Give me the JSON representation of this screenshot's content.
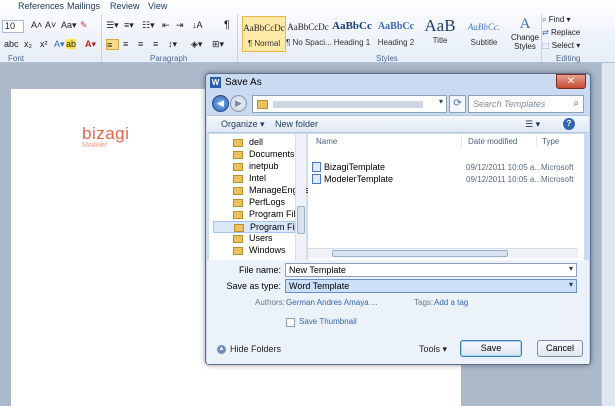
{
  "ribbon": {
    "tabs": [
      "References",
      "Mailings",
      "Review",
      "View"
    ],
    "font_size": "10",
    "groups": {
      "font": "Font",
      "paragraph": "Paragraph",
      "styles": "Styles",
      "editing": "Editing"
    },
    "styles": [
      {
        "preview": "AaBbCcDc",
        "name": "¶ Normal"
      },
      {
        "preview": "AaBbCcDc",
        "name": "¶ No Spaci..."
      },
      {
        "preview": "AaBbCc",
        "name": "Heading 1"
      },
      {
        "preview": "AaBbCc",
        "name": "Heading 2"
      },
      {
        "preview": "AaB",
        "name": "Title"
      },
      {
        "preview": "AaBbCc.",
        "name": "Subtitle"
      }
    ],
    "change_styles": "Change Styles",
    "editing": {
      "find": "Find",
      "replace": "Replace",
      "select": "Select"
    }
  },
  "document": {
    "logo_main": "bizagi",
    "logo_sub": "Modeler"
  },
  "dialog": {
    "title": "Save As",
    "search_placeholder": "Search Templates",
    "toolbar": {
      "organize": "Organize",
      "new_folder": "New folder"
    },
    "nav_items": [
      "dell",
      "Documents",
      "inetpub",
      "Intel",
      "ManageEngine",
      "PerfLogs",
      "Program Files",
      "Program Files (",
      "Users",
      "Windows"
    ],
    "columns": {
      "name": "Name",
      "date": "Date modified",
      "type": "Type"
    },
    "files": [
      {
        "name": "BizagiTemplate",
        "date": "09/12/2011 10:05 a...",
        "type": "Microsoft"
      },
      {
        "name": "ModelerTemplate",
        "date": "09/12/2011 10:05 a...",
        "type": "Microsoft"
      }
    ],
    "file_name_label": "File name:",
    "file_name_value": "New Template",
    "save_type_label": "Save as type:",
    "save_type_value": "Word Template",
    "authors_label": "Authors:",
    "authors_value": "German Andres Amaya ...",
    "tags_label": "Tags:",
    "tags_value": "Add a tag",
    "save_thumbnail": "Save Thumbnail",
    "hide_folders": "Hide Folders",
    "tools": "Tools",
    "save": "Save",
    "cancel": "Cancel"
  }
}
